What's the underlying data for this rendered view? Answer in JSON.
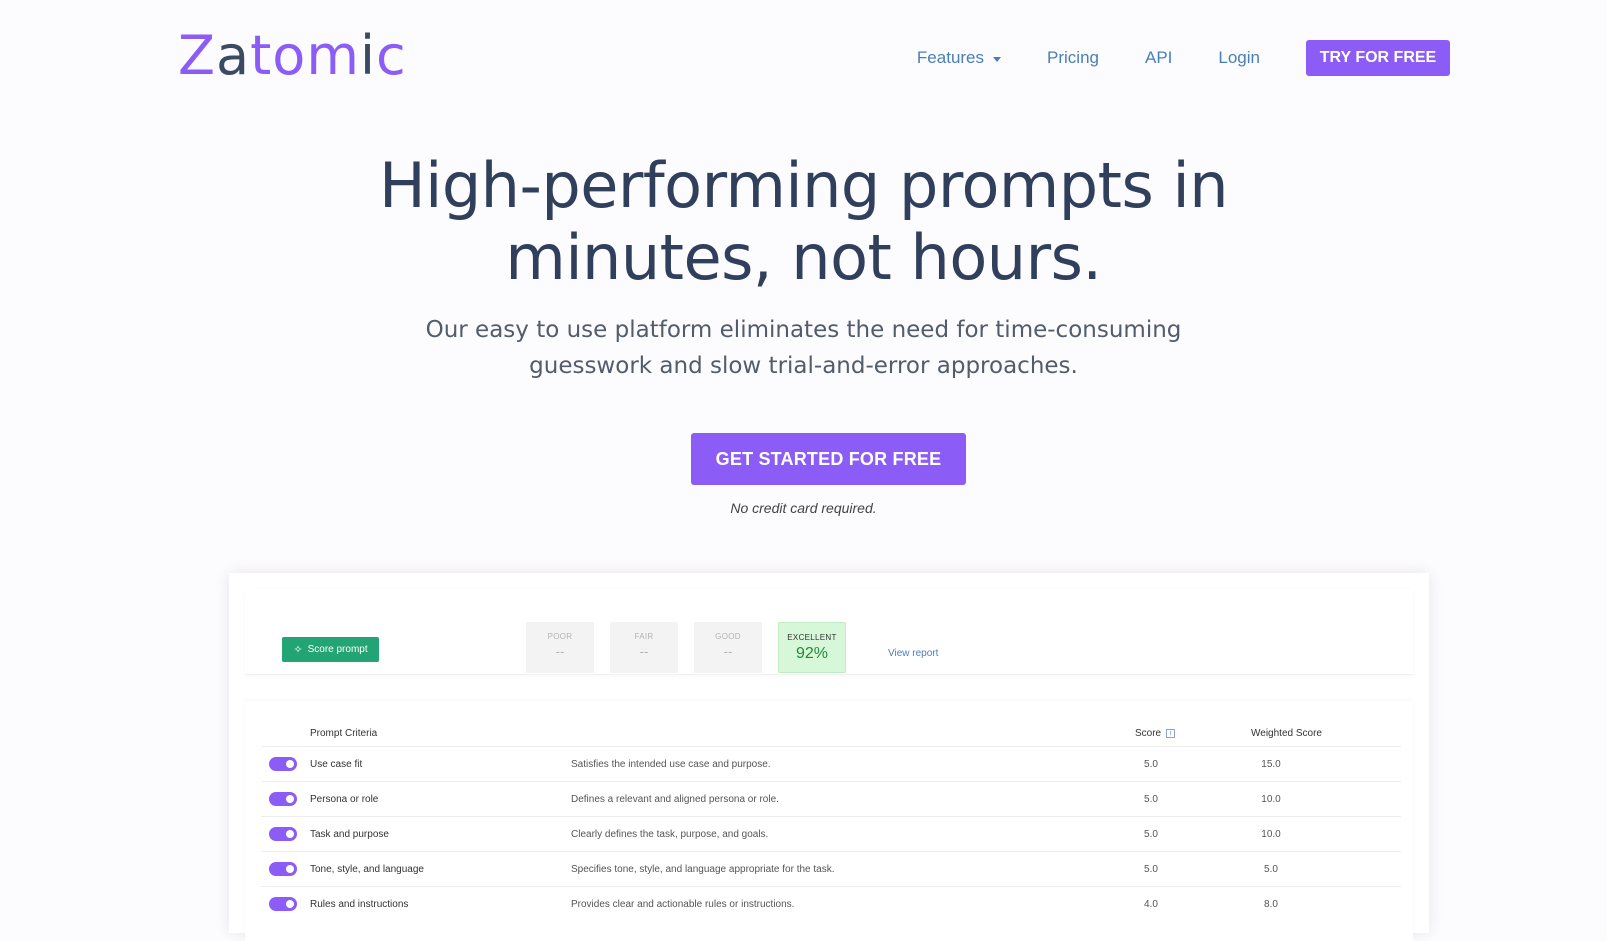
{
  "brand": {
    "logo_chars": [
      {
        "ch": "Z",
        "c": "p"
      },
      {
        "ch": "a",
        "c": "d"
      },
      {
        "ch": "t",
        "c": "p"
      },
      {
        "ch": "o",
        "c": "p"
      },
      {
        "ch": "m",
        "c": "p"
      },
      {
        "ch": "i",
        "c": "d"
      },
      {
        "ch": "c",
        "c": "p"
      }
    ],
    "accent": "#8b5cf6"
  },
  "nav": {
    "features": "Features",
    "pricing": "Pricing",
    "api": "API",
    "login": "Login",
    "try": "TRY FOR FREE"
  },
  "hero": {
    "title_line1": "High-performing prompts in",
    "title_line2": "minutes, not hours.",
    "sub_line1": "Our easy to use platform eliminates the need for time-consuming",
    "sub_line2": "guesswork and slow trial-and-error approaches.",
    "cta": "GET STARTED FOR FREE",
    "note": "No credit card required."
  },
  "scorecard": {
    "button": "Score prompt",
    "tiers": [
      {
        "label": "POOR",
        "value": "--"
      },
      {
        "label": "FAIR",
        "value": "--"
      },
      {
        "label": "GOOD",
        "value": "--"
      },
      {
        "label": "EXCELLENT",
        "value": "92%"
      }
    ],
    "view_report": "View report"
  },
  "criteria": {
    "headers": {
      "name": "Prompt Criteria",
      "score": "Score",
      "weighted": "Weighted Score"
    },
    "rows": [
      {
        "name": "Use case fit",
        "desc": "Satisfies the intended use case and purpose.",
        "score": "5.0",
        "weighted": "15.0"
      },
      {
        "name": "Persona or role",
        "desc": "Defines a relevant and aligned persona or role.",
        "score": "5.0",
        "weighted": "10.0"
      },
      {
        "name": "Task and purpose",
        "desc": "Clearly defines the task, purpose, and goals.",
        "score": "5.0",
        "weighted": "10.0"
      },
      {
        "name": "Tone, style, and language",
        "desc": "Specifies tone, style, and language appropriate for the task.",
        "score": "5.0",
        "weighted": "5.0"
      },
      {
        "name": "Rules and instructions",
        "desc": "Provides clear and actionable rules or instructions.",
        "score": "4.0",
        "weighted": "8.0"
      }
    ]
  }
}
